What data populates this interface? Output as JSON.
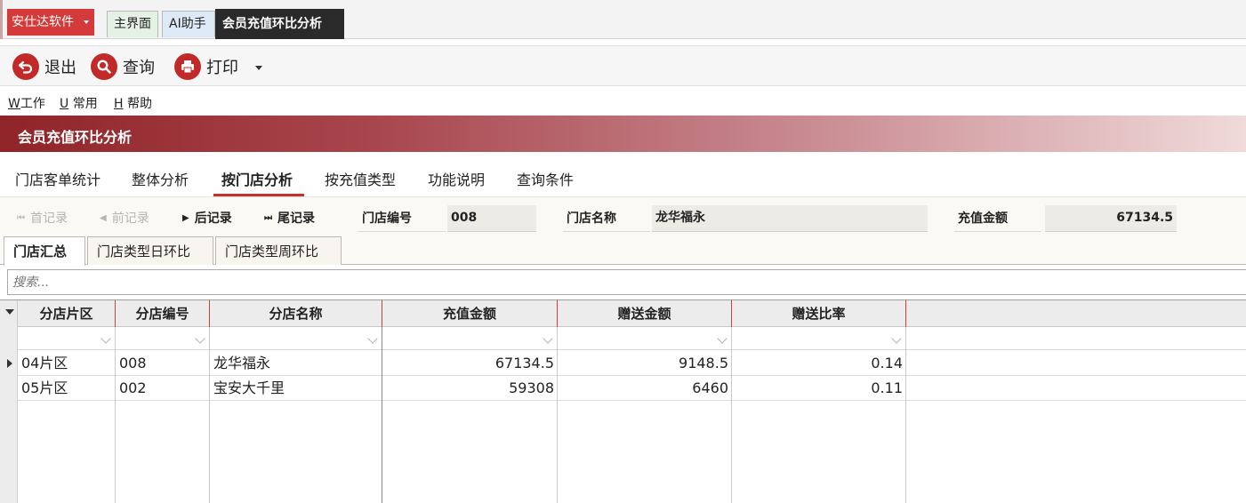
{
  "app": {
    "brand": "安仕达软件",
    "tabs": [
      "主界面",
      "AI助手",
      "会员充值环比分析"
    ]
  },
  "toolbar": {
    "exit_label": "退出",
    "query_label": "查询",
    "print_label": "打印"
  },
  "menu": {
    "work_key": "W",
    "work_label": "工作",
    "common_key": "U",
    "common_label": " 常用",
    "help_key": "H",
    "help_label": " 帮助"
  },
  "banner": {
    "title": "会员充值环比分析"
  },
  "page_tabs": [
    "门店客单统计",
    "整体分析",
    "按门店分析",
    "按充值类型",
    "功能说明",
    "查询条件"
  ],
  "active_page_tab": "按门店分析",
  "record_nav": {
    "first": "首记录",
    "prev": "前记录",
    "next": "后记录",
    "last": "尾记录"
  },
  "fields": {
    "store_no_label": "门店编号",
    "store_no_value": "008",
    "store_name_label": "门店名称",
    "store_name_value": "龙华福永",
    "amount_label": "充值金额",
    "amount_value": "67134.5"
  },
  "sub_tabs": [
    "门店汇总",
    "门店类型日环比",
    "门店类型周环比"
  ],
  "search": {
    "placeholder": "搜索..."
  },
  "grid": {
    "columns": [
      "分店片区",
      "分店编号",
      "分店名称",
      "充值金额",
      "赠送金额",
      "赠送比率"
    ],
    "rows": [
      [
        "04片区",
        "008",
        "龙华福永",
        "67134.5",
        "9148.5",
        "0.14"
      ],
      [
        "05片区",
        "002",
        "宝安大千里",
        "59308",
        "6460",
        "0.11"
      ]
    ]
  },
  "colors": {
    "brand": "#d43a3a",
    "accent": "#c8302f",
    "banner_start": "#8f2428",
    "active_tab_bg": "#2a2a2a"
  }
}
